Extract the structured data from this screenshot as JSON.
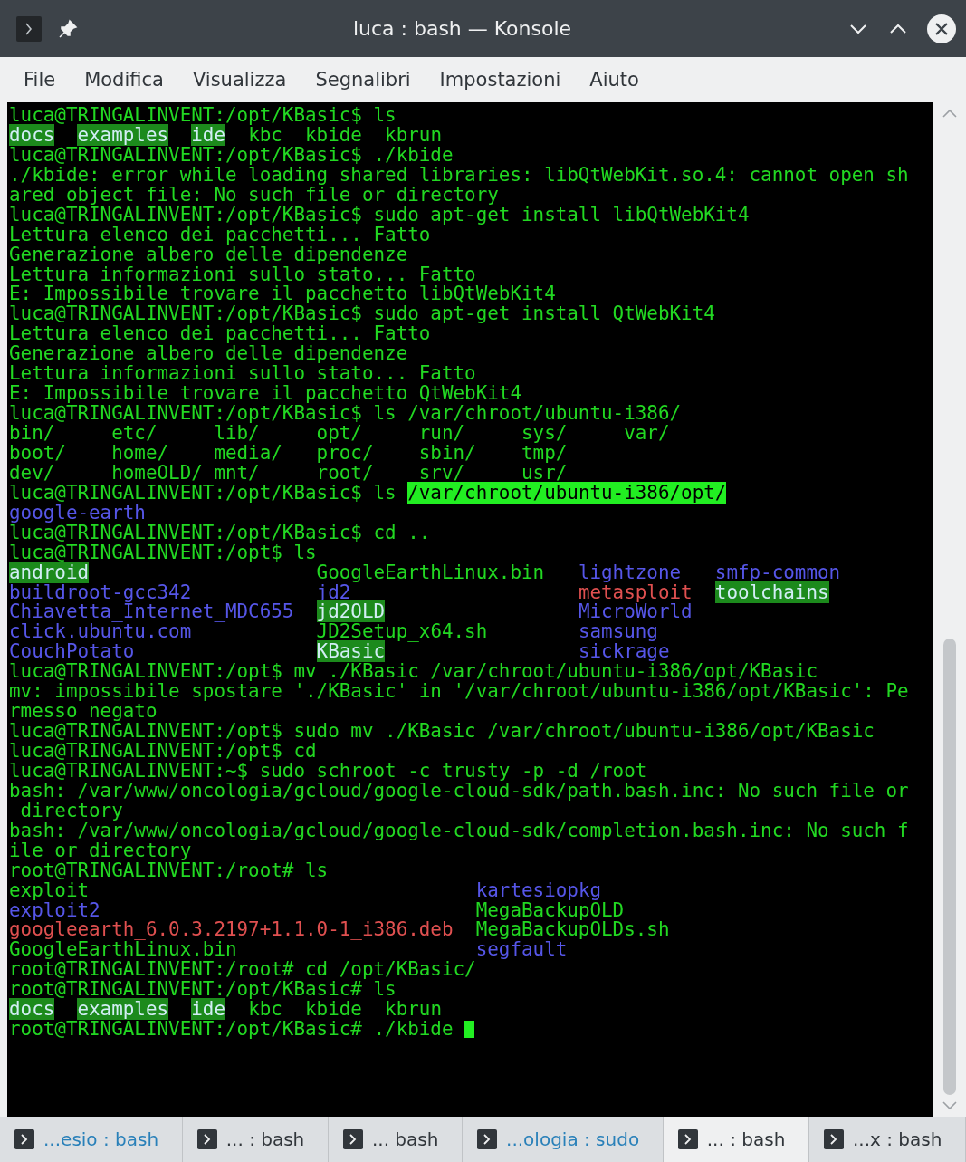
{
  "window": {
    "title": "luca : bash — Konsole"
  },
  "menu": [
    "File",
    "Modifica",
    "Visualizza",
    "Segnalibri",
    "Impostazioni",
    "Aiuto"
  ],
  "terminal": {
    "cursor": true,
    "lines": [
      [
        {
          "text": "luca@TRINGALINVENT:/opt/KBasic$ ls",
          "kind": "plain"
        }
      ],
      [
        {
          "text": "docs",
          "kind": "dir-highlight"
        },
        {
          "text": "  examples",
          "kind": "dir-highlight"
        },
        {
          "text": "  ide",
          "kind": "dir-highlight"
        },
        {
          "text": "  kbc  kbide  kbrun",
          "kind": "plain"
        }
      ],
      [
        {
          "text": "luca@TRINGALINVENT:/opt/KBasic$ ./kbide",
          "kind": "plain"
        }
      ],
      [
        {
          "text": "./kbide: error while loading shared libraries: libQtWebKit.so.4: cannot open sh",
          "kind": "plain"
        }
      ],
      [
        {
          "text": "ared object file: No such file or directory",
          "kind": "plain"
        }
      ],
      [
        {
          "text": "luca@TRINGALINVENT:/opt/KBasic$ sudo apt-get install libQtWebKit4",
          "kind": "plain"
        }
      ],
      [
        {
          "text": "Lettura elenco dei pacchetti... Fatto",
          "kind": "plain"
        }
      ],
      [
        {
          "text": "Generazione albero delle dipendenze",
          "kind": "plain"
        }
      ],
      [
        {
          "text": "Lettura informazioni sullo stato... Fatto",
          "kind": "plain"
        }
      ],
      [
        {
          "text": "E: Impossibile trovare il pacchetto libQtWebKit4",
          "kind": "plain"
        }
      ],
      [
        {
          "text": "luca@TRINGALINVENT:/opt/KBasic$ sudo apt-get install QtWebKit4",
          "kind": "plain"
        }
      ],
      [
        {
          "text": "Lettura elenco dei pacchetti... Fatto",
          "kind": "plain"
        }
      ],
      [
        {
          "text": "Generazione albero delle dipendenze",
          "kind": "plain"
        }
      ],
      [
        {
          "text": "Lettura informazioni sullo stato... Fatto",
          "kind": "plain"
        }
      ],
      [
        {
          "text": "E: Impossibile trovare il pacchetto QtWebKit4",
          "kind": "plain"
        }
      ],
      [
        {
          "text": "luca@TRINGALINVENT:/opt/KBasic$ ls /var/chroot/ubuntu-i386/",
          "kind": "plain"
        }
      ],
      [
        {
          "text": "bin/     etc/     lib/     opt/     run/     sys/     var/",
          "kind": "plain"
        }
      ],
      [
        {
          "text": "boot/    home/    media/   proc/    sbin/    tmp/",
          "kind": "plain"
        }
      ],
      [
        {
          "text": "dev/     homeOLD/ mnt/     root/    srv/     usr/",
          "kind": "plain"
        }
      ],
      [
        {
          "text": "luca@TRINGALINVENT:/opt/KBasic$ ls ",
          "kind": "plain"
        },
        {
          "text": "/var/chroot/ubuntu-i386/opt/",
          "kind": "selection"
        }
      ],
      [
        {
          "text": "google-earth",
          "kind": "dir"
        }
      ],
      [
        {
          "text": "luca@TRINGALINVENT:/opt/KBasic$ cd ..",
          "kind": "plain"
        }
      ],
      [
        {
          "text": "luca@TRINGALINVENT:/opt$ ls",
          "kind": "plain"
        }
      ],
      [
        {
          "text": "android",
          "kind": "dir-highlight"
        },
        {
          "text": "                    GoogleEarthLinux.bin   ",
          "kind": "plain"
        },
        {
          "text": "lightzone   smfp-common",
          "kind": "dir"
        }
      ],
      [
        {
          "text": "buildroot-gcc342           jd2",
          "kind": "dir"
        },
        {
          "text": "                    metasploit",
          "kind": "error"
        },
        {
          "text": "  toolchains",
          "kind": "dir-highlight"
        }
      ],
      [
        {
          "text": "Chiavetta_Internet_MDC655",
          "kind": "dir"
        },
        {
          "text": "  jd2OLD",
          "kind": "dir-highlight"
        },
        {
          "text": "                 MicroWorld",
          "kind": "dir"
        }
      ],
      [
        {
          "text": "click.ubuntu.com",
          "kind": "dir"
        },
        {
          "text": "           JD2Setup_x64.sh        ",
          "kind": "plain"
        },
        {
          "text": "samsung",
          "kind": "dir"
        }
      ],
      [
        {
          "text": "CouchPotato",
          "kind": "dir"
        },
        {
          "text": "                KBasic",
          "kind": "dir-highlight"
        },
        {
          "text": "                 sickrage",
          "kind": "dir"
        }
      ],
      [
        {
          "text": "luca@TRINGALINVENT:/opt$ mv ./KBasic /var/chroot/ubuntu-i386/opt/KBasic",
          "kind": "plain"
        }
      ],
      [
        {
          "text": "mv: impossibile spostare './KBasic' in '/var/chroot/ubuntu-i386/opt/KBasic': Pe",
          "kind": "plain"
        }
      ],
      [
        {
          "text": "rmesso negato",
          "kind": "plain"
        }
      ],
      [
        {
          "text": "luca@TRINGALINVENT:/opt$ sudo mv ./KBasic /var/chroot/ubuntu-i386/opt/KBasic",
          "kind": "plain"
        }
      ],
      [
        {
          "text": "luca@TRINGALINVENT:/opt$ cd",
          "kind": "plain"
        }
      ],
      [
        {
          "text": "luca@TRINGALINVENT:~$ sudo schroot -c trusty -p -d /root",
          "kind": "plain"
        }
      ],
      [
        {
          "text": "bash: /var/www/oncologia/gcloud/google-cloud-sdk/path.bash.inc: No such file or",
          "kind": "plain"
        }
      ],
      [
        {
          "text": " directory",
          "kind": "plain"
        }
      ],
      [
        {
          "text": "bash: /var/www/oncologia/gcloud/google-cloud-sdk/completion.bash.inc: No such f",
          "kind": "plain"
        }
      ],
      [
        {
          "text": "ile or directory",
          "kind": "plain"
        }
      ],
      [
        {
          "text": "root@TRINGALINVENT:/root# ls",
          "kind": "plain"
        }
      ],
      [
        {
          "text": "exploit                                  ",
          "kind": "plain"
        },
        {
          "text": "kartesiopkg",
          "kind": "dir"
        }
      ],
      [
        {
          "text": "exploit2",
          "kind": "dir"
        },
        {
          "text": "                                 MegaBackupOLD",
          "kind": "plain"
        }
      ],
      [
        {
          "text": "googleearth_6.0.3.2197+1.1.0-1_i386.deb",
          "kind": "error"
        },
        {
          "text": "  MegaBackupOLDs.sh",
          "kind": "plain"
        }
      ],
      [
        {
          "text": "GoogleEarthLinux.bin                     ",
          "kind": "plain"
        },
        {
          "text": "segfault",
          "kind": "dir"
        }
      ],
      [
        {
          "text": "root@TRINGALINVENT:/root# cd /opt/KBasic/",
          "kind": "plain"
        }
      ],
      [
        {
          "text": "root@TRINGALINVENT:/opt/KBasic# ls",
          "kind": "plain"
        }
      ],
      [
        {
          "text": "docs",
          "kind": "dir-highlight"
        },
        {
          "text": "  examples",
          "kind": "dir-highlight"
        },
        {
          "text": "  ide",
          "kind": "dir-highlight"
        },
        {
          "text": "  kbc  kbide  kbrun",
          "kind": "plain"
        }
      ],
      [
        {
          "text": "root@TRINGALINVENT:/opt/KBasic# ./kbide",
          "kind": "plain"
        }
      ]
    ]
  },
  "tabs": [
    {
      "label": "...esio : bash",
      "selected": false,
      "activity": true
    },
    {
      "label": "... : bash",
      "selected": false,
      "activity": false
    },
    {
      "label": "... bash",
      "selected": false,
      "activity": false
    },
    {
      "label": "...ologia : sudo",
      "selected": false,
      "activity": true
    },
    {
      "label": "... : bash",
      "selected": true,
      "activity": false
    },
    {
      "label": "...x : bash",
      "selected": false,
      "activity": false
    }
  ]
}
